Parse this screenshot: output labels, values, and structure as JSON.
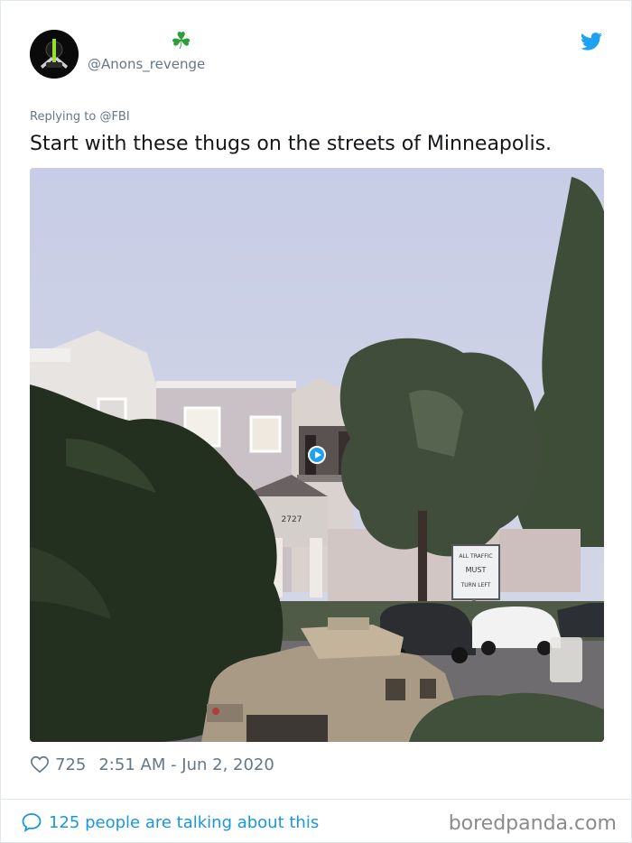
{
  "tweet": {
    "display_name": "☘",
    "handle": "@Anons_revenge",
    "replying_prefix": "Replying to",
    "replying_to": "@FBI",
    "text": "Start with these thugs on the streets of Minneapolis.",
    "likes": "725",
    "timestamp": "2:51 AM - Jun 2, 2020",
    "talking": "125 people are talking about this"
  },
  "media": {
    "building_number": "2727",
    "sign_lines": [
      "ALL TRAFFIC",
      "MUST",
      "TURN LEFT"
    ]
  },
  "watermark": "boredpanda.com",
  "colors": {
    "link_blue": "#1b95e0",
    "twitter_blue": "#1da1f2",
    "muted_gray": "#657786",
    "clover_green": "#2e9e3b"
  },
  "icons": {
    "avatar": "anonymous-avatar",
    "brand": "twitter-bird-icon",
    "like": "heart-icon",
    "conversation": "speech-bubble-icon",
    "video": "play-icon"
  }
}
